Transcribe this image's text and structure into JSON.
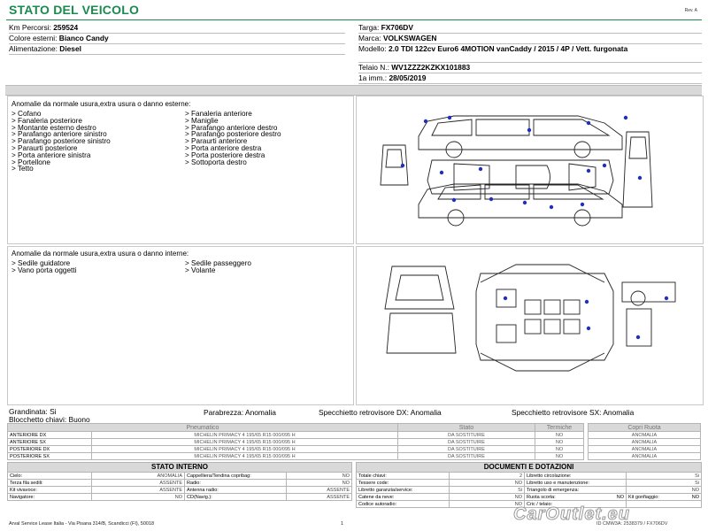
{
  "header": {
    "title": "STATO DEL VEICOLO",
    "rev": "Rev. A"
  },
  "vehicle_left": [
    {
      "label": "Km Percorsi:",
      "value": "259524"
    },
    {
      "label": "Colore esterni:",
      "value": "Bianco Candy"
    },
    {
      "label": "Alimentazione:",
      "value": "Diesel"
    }
  ],
  "vehicle_right": {
    "plate": {
      "label": "Targa:",
      "value": "FX706DV"
    },
    "brand": {
      "label": "Marca:",
      "value": "VOLKSWAGEN"
    },
    "model": {
      "label": "Modello:",
      "value": "2.0 TDI 122cv Euro6 4MOTION vanCaddy / 2015 / 4P / Vett. furgonata"
    },
    "vin": {
      "label": "Telaio N.:",
      "value": "WV1ZZZ2KZKX101883"
    },
    "first_reg": {
      "label": "1a imm.:",
      "value": "28/05/2019"
    }
  },
  "exterior": {
    "title": "Anomalie da normale usura,extra usura o danno esterne:",
    "col1": [
      "> Cofano",
      "> Fanaleria posteriore",
      "> Montante esterno destro",
      "> Parafango anteriore sinistro",
      "> Parafango posteriore sinistro",
      "> Paraurti posteriore",
      "> Porta anteriore sinistra",
      "> Portellone",
      "> Tetto"
    ],
    "col2": [
      "> Fanaleria anteriore",
      "> Maniglie",
      "> Parafango anteriore destro",
      "> Parafango posteriore destro",
      "> Paraurti anteriore",
      "> Porta anteriore destra",
      "> Porta posteriore destra",
      "> Sottoporta destro"
    ]
  },
  "interior": {
    "title": "Anomalie da normale usura,extra usura o danno interne:",
    "col1": [
      "> Sedile guidatore",
      "> Vano porta oggetti"
    ],
    "col2": [
      "> Sedile passeggero",
      "> Volante"
    ]
  },
  "summary": {
    "hail": "Grandinata: Si",
    "keys": "Blocchetto chiavi: Buono",
    "windshield": "Parabrezza: Anomalia",
    "mirror_dx": "Specchietto retrovisore DX: Anomalia",
    "mirror_sx": "Specchietto retrovisore SX: Anomalia"
  },
  "tyres": {
    "headers": [
      "Pneumatico",
      "Stato",
      "Termiche"
    ],
    "rows": [
      {
        "pos": "ANTERIORE DX",
        "tyre": "MICHELIN PRIMACY 4 195/65 R15 000/095 H",
        "state": "DA SOSTITUIRE",
        "winter": "NO"
      },
      {
        "pos": "ANTERIORE SX",
        "tyre": "MICHELIN PRIMACY 4 195/65 R15 000/095 H",
        "state": "DA SOSTITUIRE",
        "winter": "NO"
      },
      {
        "pos": "POSTERIORE DX",
        "tyre": "MICHELIN PRIMACY 4 195/65 R15 000/095 H",
        "state": "DA SOSTITUIRE",
        "winter": "NO"
      },
      {
        "pos": "POSTERIORE SX",
        "tyre": "MICHELIN PRIMACY 4 195/65 R15 000/095 H",
        "state": "DA SOSTITUIRE",
        "winter": "NO"
      }
    ],
    "hub_header": "Copri Ruota",
    "hubs": [
      "ANOMALIA",
      "ANOMALIA",
      "ANOMALIA",
      "ANOMALIA"
    ]
  },
  "internal_state": {
    "title": "STATO INTERNO",
    "rows": [
      [
        "Cielo:",
        "ANOMALIA",
        "Cappelliera/Tendina copribag:",
        "NO"
      ],
      [
        "Terza fila sedili:",
        "ASSENTE",
        "Radio:",
        "NO"
      ],
      [
        "Kit vivavoce:",
        "ASSENTE",
        "Antenna radio:",
        "ASSENTE"
      ],
      [
        "Navigatore:",
        "NO",
        "CD(Navig.):",
        "ASSENTE"
      ]
    ]
  },
  "documents": {
    "title": "DOCUMENTI E DOTAZIONI",
    "rows": [
      [
        "Totale chiavi:",
        "2",
        "Libretto circolazione:",
        "Si"
      ],
      [
        "Tessere code:",
        "NO",
        "Libretto uso e manutenzione:",
        "Si"
      ],
      [
        "Libretto garanzia/service:",
        "Si",
        "Triangolo di emergenza:",
        "NO"
      ],
      [
        "Catene da neve:",
        "NO",
        "Ruota scorta:",
        "NO"
      ],
      [
        "Codice autoradio:",
        "NO",
        "Cric / telaio:",
        ""
      ]
    ],
    "extra_label": "Kit gonfiaggio:",
    "extra_value": "NO"
  },
  "footer": {
    "company": "Arval Service Lease Italia - Via Pisana 314/B, Scandicci (FI), 50018",
    "page": "1",
    "ref": "ID CMW3A: 2538379 / FX706DV",
    "watermark": "CarOutlet.eu"
  }
}
